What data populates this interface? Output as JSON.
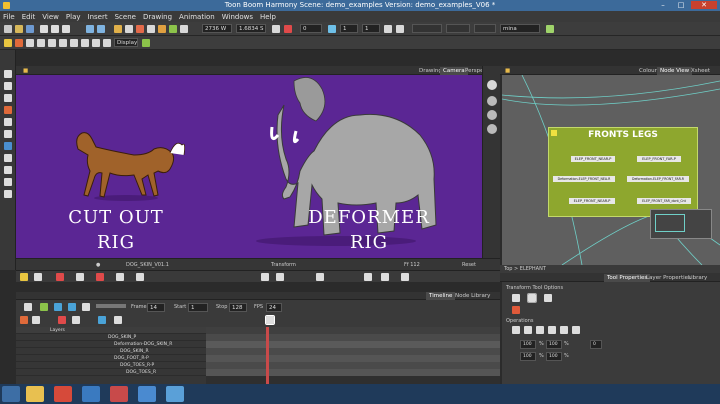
{
  "window": {
    "title": "Toon Boom Harmony Scene: demo_examples Version: demo_examples_V06 *"
  },
  "menu": [
    "File",
    "Edit",
    "View",
    "Play",
    "Insert",
    "Scene",
    "Drawing",
    "Animation",
    "Windows",
    "Help"
  ],
  "toolbar": {
    "display_value": "Display",
    "width_value": "2736 W",
    "height_value": "1.6834 S",
    "zero_value": "0",
    "mina_value": "mina",
    "one_value": "1",
    "zoom_value": "1"
  },
  "camera_view": {
    "tabs": [
      "Drawing",
      "Camera",
      "Perspective"
    ],
    "left_label_line1": "CUT OUT",
    "left_label_line2": "RIG",
    "right_label_line1": "DEFORMER",
    "right_label_line2": "RIG",
    "status_left": "DOG_SKIN_V01.1",
    "status_mid": "Transform",
    "status_right": "Ff 112",
    "status_far": "Reset"
  },
  "node_view": {
    "tabs": [
      "Colour",
      "Node View",
      "Xsheet"
    ],
    "group_title": "FRONTS LEGS",
    "nodes": [
      "ELEP_FRONT_NEAR-P",
      "ELEP_FRONT_FAR-P",
      "Deformation-ELEP_FRONT_NEA-R",
      "Deformation-ELEP_FRONT_FAR-R",
      "ELEP_FRONT_NEAR-P",
      "ELEP_FRONT_FAR_dont_Cnt"
    ],
    "footer": "Top > ELEPHANT"
  },
  "tool_properties": {
    "tabs": [
      "Tool Properties",
      "Layer Properties",
      "Library"
    ],
    "section": "Transform Tool Options",
    "operations_label": "Operations",
    "values": [
      "100",
      "100",
      "100",
      "100"
    ],
    "percent": "%",
    "zero": "0"
  },
  "timeline": {
    "tabs": [
      "Timeline",
      "Node Library"
    ],
    "frame_label": "Frame",
    "frame_value": "14",
    "start_label": "Start",
    "start_value": "1",
    "stop_label": "Stop",
    "stop_value": "128",
    "fps_label": "FPS",
    "fps_value": "24",
    "layers_label": "Layers",
    "layers": [
      "DOG_SKIN_P",
      "Deformation-DOG_SKIN_R",
      "DOG_SKIN_R",
      "DOG_FOOT_R-P",
      "DOG_TOES_R-P",
      "DOG_TOES_R"
    ]
  },
  "colors": {
    "stage_bg": "#5b2694",
    "node_group": "#8ea72e",
    "accent": "#3c6a9a"
  }
}
